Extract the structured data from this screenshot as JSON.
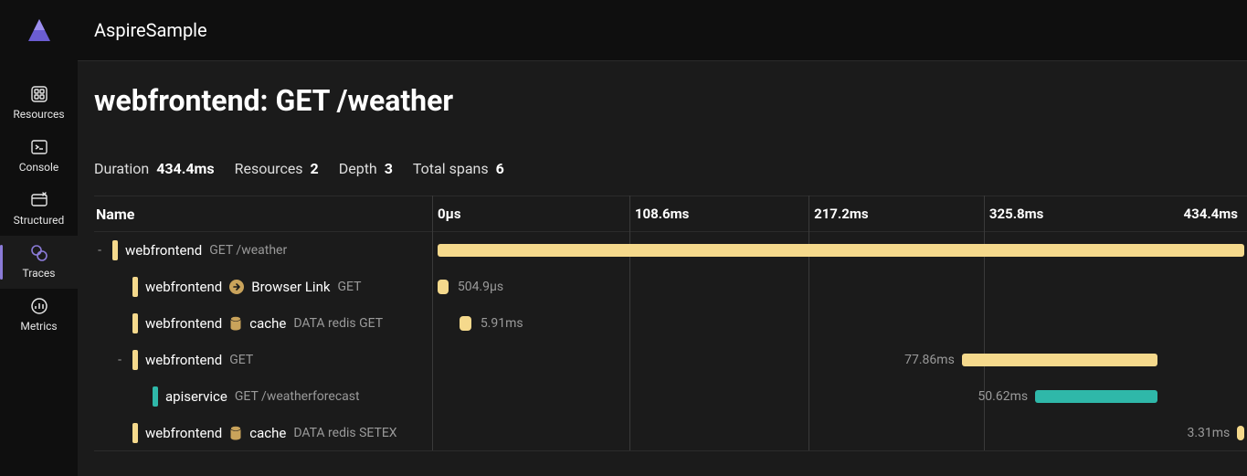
{
  "app_title": "AspireSample",
  "sidebar": {
    "items": [
      {
        "label": "Resources",
        "active": false
      },
      {
        "label": "Console",
        "active": false
      },
      {
        "label": "Structured",
        "active": false
      },
      {
        "label": "Traces",
        "active": true
      },
      {
        "label": "Metrics",
        "active": false
      }
    ]
  },
  "page_title": "webfrontend: GET /weather",
  "stats": {
    "duration_label": "Duration",
    "duration_value": "434.4ms",
    "resources_label": "Resources",
    "resources_value": "2",
    "depth_label": "Depth",
    "depth_value": "3",
    "spans_label": "Total spans",
    "spans_value": "6"
  },
  "columns": {
    "name": "Name"
  },
  "time_ticks": [
    "0µs",
    "108.6ms",
    "217.2ms",
    "325.8ms",
    "434.4ms"
  ],
  "colors": {
    "yellow": "#f5d98c",
    "teal": "#2fb8a9"
  },
  "spans": [
    {
      "indent": 0,
      "collapsible": true,
      "resource": "webfrontend",
      "suffix": "GET /weather",
      "color": "yellow",
      "start_pct": 0.7,
      "width_pct": 99.0,
      "duration_text": ""
    },
    {
      "indent": 1,
      "collapsible": false,
      "resource": "webfrontend",
      "outgoing": true,
      "out_target": "Browser Link",
      "suffix": "GET",
      "color": "yellow",
      "start_pct": 0.7,
      "width_pct": 1.3,
      "duration_text": "504.9µs",
      "label_side": "right"
    },
    {
      "indent": 1,
      "collapsible": false,
      "resource": "webfrontend",
      "db": true,
      "db_target": "cache",
      "suffix": "DATA redis GET",
      "color": "yellow",
      "start_pct": 3.4,
      "width_pct": 1.4,
      "duration_text": "5.91ms",
      "label_side": "right"
    },
    {
      "indent": 1,
      "collapsible": true,
      "resource": "webfrontend",
      "suffix": "GET",
      "color": "yellow",
      "start_pct": 65.0,
      "width_pct": 24.0,
      "duration_text": "77.86ms",
      "label_side": "left"
    },
    {
      "indent": 2,
      "collapsible": false,
      "resource": "apiservice",
      "suffix": "GET /weatherforecast",
      "color": "teal",
      "start_pct": 74.0,
      "width_pct": 15.0,
      "duration_text": "50.62ms",
      "label_side": "left"
    },
    {
      "indent": 1,
      "collapsible": false,
      "resource": "webfrontend",
      "db": true,
      "db_target": "cache",
      "suffix": "DATA redis SETEX",
      "color": "yellow",
      "start_pct": 98.8,
      "width_pct": 0.9,
      "duration_text": "3.31ms",
      "label_side": "left"
    }
  ]
}
